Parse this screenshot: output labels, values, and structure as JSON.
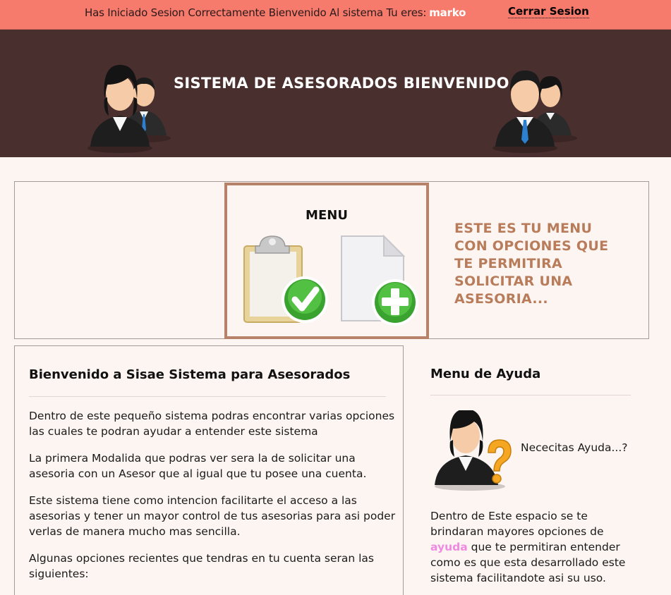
{
  "topbar": {
    "message": "Has Iniciado Sesion Correctamente Bienvenido Al sistema Tu eres:",
    "username": "marko",
    "logout_label": "Cerrar Sesion"
  },
  "header": {
    "title": "SISTEMA DE ASESORADOS BIENVENIDO"
  },
  "menu": {
    "title": "MENU",
    "description": "ESTE ES TU MENU CON OPCIONES QUE TE PERMITIRA SOLICITAR UNA ASESORIA...",
    "icons": [
      "clipboard-check-icon",
      "new-document-add-icon"
    ]
  },
  "welcome": {
    "heading": "Bienvenido a Sisae Sistema para Asesorados",
    "paragraphs": [
      "Dentro de este pequeño sistema podras encontrar varias opciones las cuales te podran ayudar a entender este sistema",
      "La primera Modalida que podras ver sera la de solicitar una asesoria con un Asesor que al igual que tu posee una cuenta.",
      "Este sistema tiene como intencion facilitarte el acceso a las asesorias y tener un mayor control de tus asesorias para asi poder verlas de manera mucho mas sencilla.",
      "Algunas opciones recientes que tendras en tu cuenta seran las siguientes:"
    ]
  },
  "help": {
    "heading": "Menu de Ayuda",
    "question": "Nececitas Ayuda...?",
    "text_before": "Dentro de Este espacio se te brindaran mayores opciones de",
    "link_label": "ayuda",
    "text_after": "que te permitiran entender como es que esta desarrollado este sistema facilitandote asi su uso."
  },
  "colors": {
    "topbar": "#f77b6c",
    "header": "#4a2f2f",
    "menu_accent": "#b97c5a",
    "link": "#f08ae0"
  }
}
